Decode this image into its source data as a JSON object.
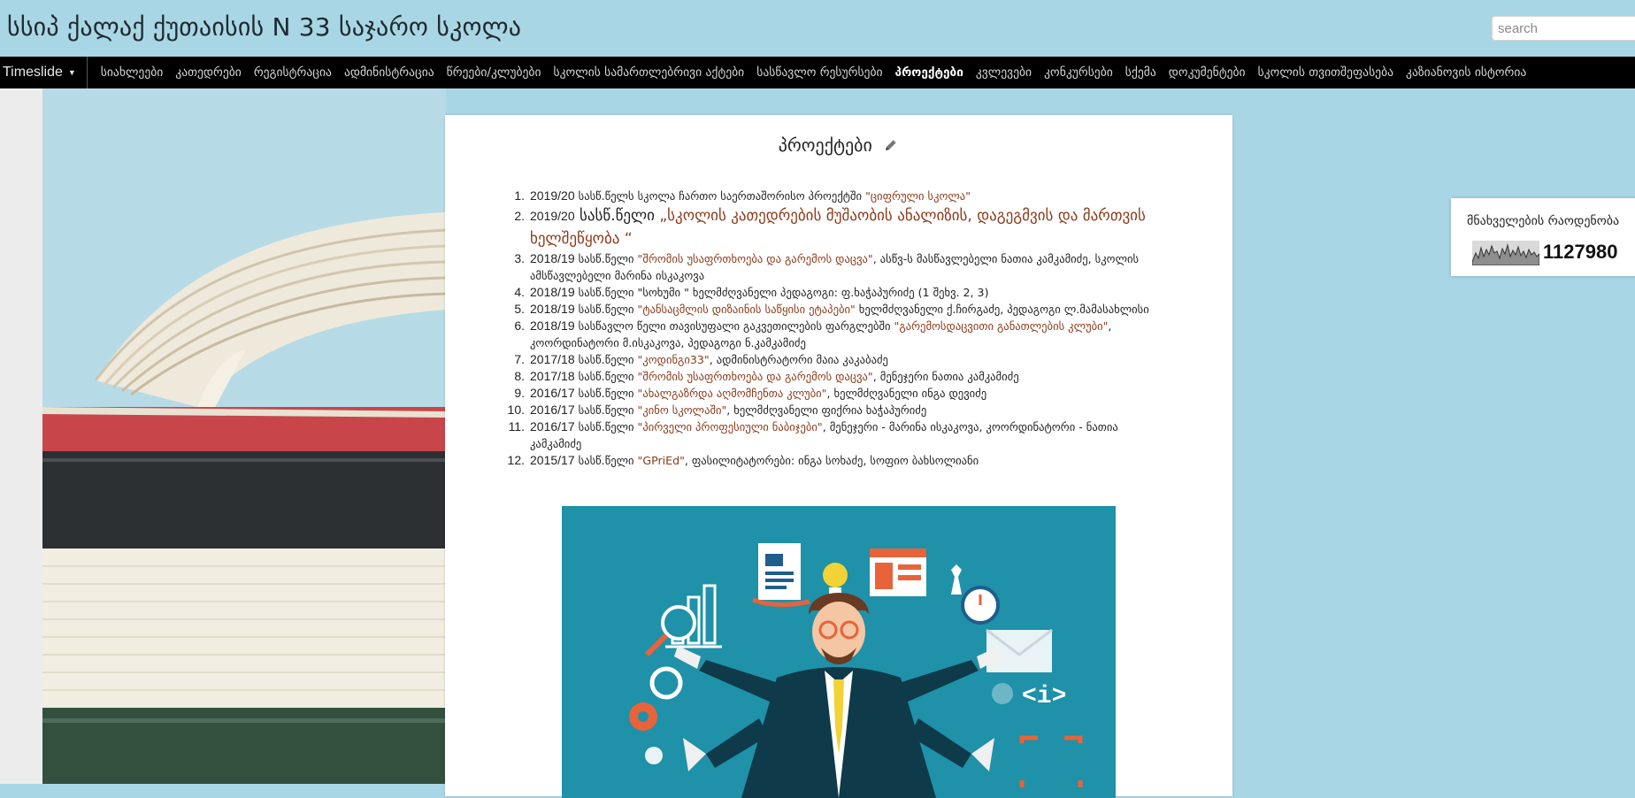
{
  "header": {
    "site_title": "სსიპ ქალაქ ქუთაისის N 33 საჯარო სკოლა",
    "search_placeholder": "search"
  },
  "navbar": {
    "dropdown_label": "Timeslide",
    "items": [
      {
        "label": "სიახლეები",
        "active": false
      },
      {
        "label": "კათედრები",
        "active": false
      },
      {
        "label": "რეგისტრაცია",
        "active": false
      },
      {
        "label": "ადმინისტრაცია",
        "active": false
      },
      {
        "label": "წრეები/კლუბები",
        "active": false
      },
      {
        "label": "სკოლის სამართლებრივი აქტები",
        "active": false
      },
      {
        "label": "სასწავლო რესურსები",
        "active": false
      },
      {
        "label": "პროექტები",
        "active": true
      },
      {
        "label": "კვლევები",
        "active": false
      },
      {
        "label": "კონკურსები",
        "active": false
      },
      {
        "label": "სქემა",
        "active": false
      },
      {
        "label": "დოკუმენტები",
        "active": false
      },
      {
        "label": "სკოლის თვითშეფასება",
        "active": false
      },
      {
        "label": "კაზიანოვის ისტორია",
        "active": false
      }
    ]
  },
  "main": {
    "page_title": "პროექტები",
    "projects": [
      {
        "num": "1.",
        "year": "2019/20",
        "pre": " სასწ.წელს სკოლა ჩართო საერთაშორისო პროექტში ",
        "highlight": "\"ციფრული სკოლა\"",
        "post": ""
      },
      {
        "num": "2.",
        "year": "2019/20",
        "pre": " სასწ.წელი ",
        "highlight": "„სკოლის კათედრების მუშაობის ანალიზის, დაგეგმვის და მართვის ხელშეწყობა “",
        "post": ""
      },
      {
        "num": "3.",
        "year": "2018/19",
        "pre": " სასწ.წელი ",
        "highlight": "\"შრომის უსაფრთხოება და გარემოს დაცვა\"",
        "post": ", ასწვ-ს მასწავლებელი ნათია კამკამიძე, სკოლის ამსწავლებელი მარინა ისკაკოვა"
      },
      {
        "num": "4.",
        "year": "2018/19",
        "pre": " სასწ.წელი \"სოხუმი \" ხელმძღვანელი პედაგოგი: ფ.ხაჭაპურიძე (1 შეხვ. 2, 3)",
        "highlight": "",
        "post": ""
      },
      {
        "num": "5.",
        "year": "2018/19",
        "pre": " სასწ.წელი ",
        "highlight": "\"ტანსაცმლის დიზაინის საწყისი ეტაპები\"",
        "post": " ხელმძღვანელი ქ.ჩირგაძე, პედაგოგი ლ.მამასახლისი"
      },
      {
        "num": "6.",
        "year": "2018/19",
        "pre": " სასწავლო წელი თავისუფალი გაკვეთილების ფარგლებში ",
        "highlight": "\"გარემოსდაცვითი განათლების კლუბი\"",
        "post": ", კოორდინატორი მ.ისკაკოვა, პედაგოგი ნ.კამკამიძე"
      },
      {
        "num": "7.",
        "year": "2017/18",
        "pre": " სასწ.წელი ",
        "highlight": "\"კოდინგი33\"",
        "post": ", ადმინისტრატორი მაია კაკაბაძე"
      },
      {
        "num": "8.",
        "year": "2017/18",
        "pre": " სასწ.წელი ",
        "highlight": "\"შრომის უსაფრთხოება და გარემოს დაცვა\"",
        "post": ", მენეჯერი ნათია კამკამიძე"
      },
      {
        "num": "9.",
        "year": "2016/17",
        "pre": " სასწ.წელი ",
        "highlight": "\"ახალგაზრდა აღმომჩენთა კლუბი\"",
        "post": ", ხელმძღვანელი ინგა დევიძე"
      },
      {
        "num": "10.",
        "year": "2016/17",
        "pre": " სასწ.წელი ",
        "highlight": "\"კინო სკოლაში\"",
        "post": ", ხელმძღვანელი ფიქრია ხაჭაპურიძე"
      },
      {
        "num": "11.",
        "year": "2016/17",
        "pre": " სასწ.წელი ",
        "highlight": "\"პირველი პროფესიული ნაბიჯები\"",
        "post": ", მენეჯერი - მარინა ისკაკოვა, კოორდინატორი - ნათია კამკამიძე"
      },
      {
        "num": "12.",
        "year": "2015/17",
        "pre": " სასწ.წელი ",
        "highlight": "\"GPriEd\"",
        "post": ", ფასილიტატორები: ინგა სოხაძე, სოფიო ბახსოლიანი"
      }
    ]
  },
  "counter": {
    "title": "მნახველების რაოდენობა",
    "value": "1127980"
  },
  "colors": {
    "link": "#8b3a1a",
    "navbar_bg": "#000000",
    "page_bg": "#a9d6e4",
    "illustration_bg": "#1f91a8"
  },
  "icons": [
    "pencil-icon",
    "caret-down-icon",
    "sparkline-icon"
  ]
}
